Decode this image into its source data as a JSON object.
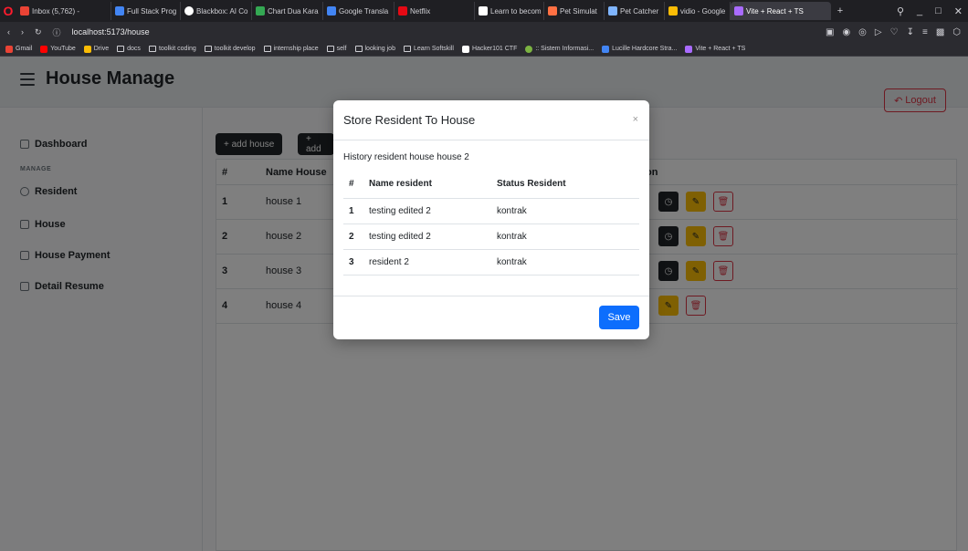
{
  "browser": {
    "tabs": [
      {
        "label": "Inbox (5,762) -",
        "color": "#ea4335"
      },
      {
        "label": "Full Stack Prog",
        "color": "#4285f4"
      },
      {
        "label": "Blackbox: AI Co",
        "color": "#ffffff"
      },
      {
        "label": "Chart Dua Kara",
        "color": "#34a853"
      },
      {
        "label": "Google Transla",
        "color": "#4285f4"
      },
      {
        "label": "Netflix",
        "color": "#e50914"
      },
      {
        "label": "Learn to becom",
        "color": "#ffffff"
      },
      {
        "label": "Pet Simulat",
        "color": "#ff7043"
      },
      {
        "label": "Pet Catcher",
        "color": "#7fb5ff"
      },
      {
        "label": "vidio - Google",
        "color": "#fbbc05"
      },
      {
        "label": "Vite + React + TS",
        "color": "#a96bff"
      }
    ],
    "url": "localhost:5173/house",
    "bookmarks": [
      "Gmail",
      "YouTube",
      "Drive",
      "docs",
      "toolkit coding",
      "toolkit develop",
      "internship place",
      "self",
      "looking job",
      "Learn Softskill",
      "Hacker101 CTF",
      ":: Sistem Informasi...",
      "Lucille Hardcore Stra...",
      "Vite + React + TS"
    ]
  },
  "header": {
    "title": "House Manage",
    "logout_label": "Logout"
  },
  "sidebar": {
    "section_label": "MANAGE",
    "items": [
      "Dashboard",
      "Resident",
      "House",
      "House Payment",
      "Detail Resume"
    ]
  },
  "toolbar": {
    "add_house_label": "+ add house",
    "add_other_label": "+ add"
  },
  "main_table": {
    "headers": [
      "#",
      "Name House",
      "on"
    ],
    "rows": [
      {
        "num": "1",
        "name": "house 1"
      },
      {
        "num": "2",
        "name": "house 2"
      },
      {
        "num": "3",
        "name": "house 3"
      },
      {
        "num": "4",
        "name": "house 4"
      }
    ]
  },
  "modal": {
    "title": "Store Resident To House",
    "close_label": "×",
    "history_title": "History resident house house 2",
    "headers": [
      "#",
      "Name resident",
      "Status Resident"
    ],
    "rows": [
      {
        "num": "1",
        "name": "testing edited 2",
        "status": "kontrak"
      },
      {
        "num": "2",
        "name": "testing edited 2",
        "status": "kontrak"
      },
      {
        "num": "3",
        "name": "resident 2",
        "status": "kontrak"
      }
    ],
    "save_label": "Save"
  },
  "colors": {
    "primary": "#0d6efd",
    "danger": "#dc3545",
    "warning": "#ffc107",
    "dark": "#212529"
  }
}
